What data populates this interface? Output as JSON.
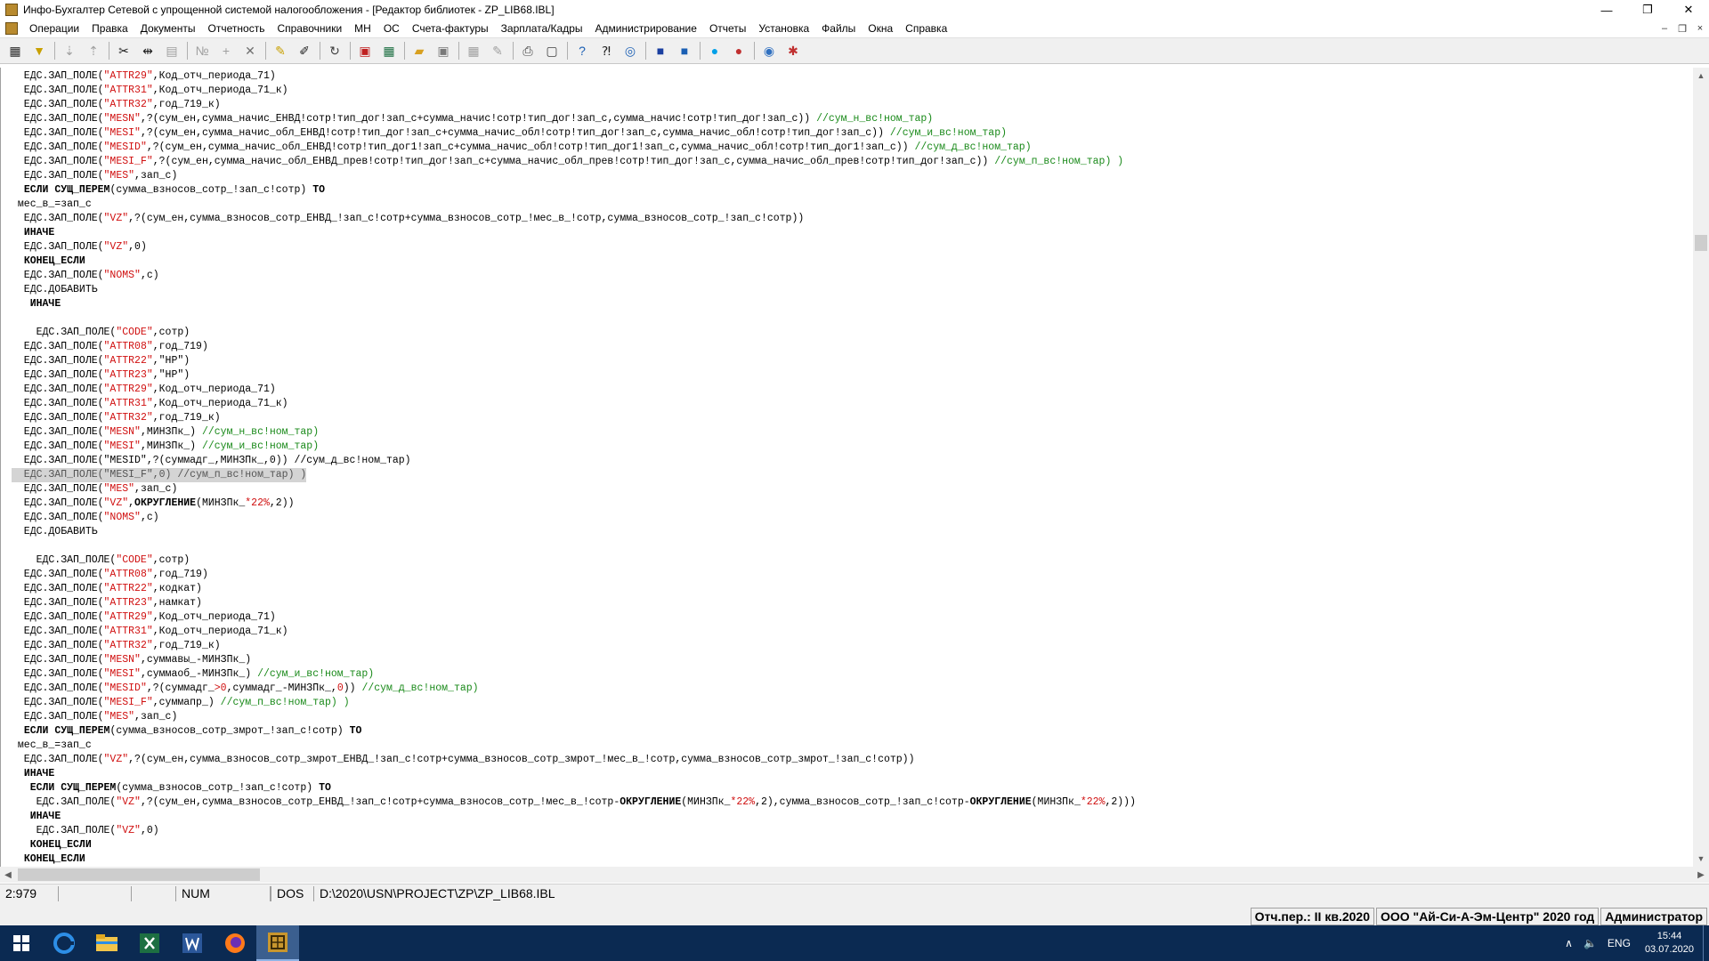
{
  "window": {
    "title": "Инфо-Бухгалтер Сетевой с упрощенной системой налогообложения - [Редактор библиотек - ZP_LIB68.IBL]",
    "minimize_glyph": "—",
    "restore_glyph": "❐",
    "close_glyph": "✕"
  },
  "menu": {
    "items": [
      "Операции",
      "Правка",
      "Документы",
      "Отчетность",
      "Справочники",
      "МН",
      "ОС",
      "Счета-фактуры",
      "Зарплата/Кадры",
      "Администрирование",
      "Отчеты",
      "Установка",
      "Файлы",
      "Окна",
      "Справка"
    ],
    "mdi_minimize_glyph": "–",
    "mdi_restore_glyph": "❐",
    "mdi_close_glyph": "×"
  },
  "toolbar": {
    "buttons": [
      {
        "name": "calculator-icon",
        "glyph": "▦",
        "color": "#2b2b2b"
      },
      {
        "name": "filter-icon",
        "glyph": "▼",
        "color": "#c8a000"
      },
      {
        "sep": true
      },
      {
        "name": "sort-asc-icon",
        "glyph": "⇣",
        "color": "#a0a0a0"
      },
      {
        "name": "sort-desc-icon",
        "glyph": "⇡",
        "color": "#a0a0a0"
      },
      {
        "sep": true
      },
      {
        "name": "cut-icon",
        "glyph": "✂",
        "color": "#202020"
      },
      {
        "name": "split-icon",
        "glyph": "⇹",
        "color": "#202020"
      },
      {
        "name": "paste-icon",
        "glyph": "▤",
        "color": "#a0a0a0"
      },
      {
        "sep": true
      },
      {
        "name": "number-icon",
        "glyph": "№",
        "color": "#a0a0a0"
      },
      {
        "name": "add-icon",
        "glyph": "+",
        "color": "#a0a0a0"
      },
      {
        "name": "delete-icon",
        "glyph": "✕",
        "color": "#707070"
      },
      {
        "sep": true
      },
      {
        "name": "pen-icon",
        "glyph": "✎",
        "color": "#c8a000"
      },
      {
        "name": "replace-icon",
        "glyph": "✐",
        "color": "#202020"
      },
      {
        "sep": true
      },
      {
        "name": "refresh-icon",
        "glyph": "↻",
        "color": "#404040"
      },
      {
        "sep": true
      },
      {
        "name": "pdf-icon",
        "glyph": "▣",
        "color": "#c02020"
      },
      {
        "name": "excel-icon",
        "glyph": "▦",
        "color": "#1d6f42"
      },
      {
        "sep": true
      },
      {
        "name": "open-folder-icon",
        "glyph": "▰",
        "color": "#d8a020"
      },
      {
        "name": "save-icon",
        "glyph": "▣",
        "color": "#7a7a7a"
      },
      {
        "sep": true
      },
      {
        "name": "calc-disabled-icon",
        "glyph": "▦",
        "color": "#a0a0a0"
      },
      {
        "name": "edit-disabled-icon",
        "glyph": "✎",
        "color": "#a0a0a0"
      },
      {
        "sep": true
      },
      {
        "name": "print-icon",
        "glyph": "⎙",
        "color": "#404040"
      },
      {
        "name": "preview-icon",
        "glyph": "▢",
        "color": "#404040"
      },
      {
        "sep": true
      },
      {
        "name": "help-icon",
        "glyph": "?",
        "color": "#1a5fb4"
      },
      {
        "name": "context-help-icon",
        "glyph": "⁈",
        "color": "#202020"
      },
      {
        "name": "compass-icon",
        "glyph": "◎",
        "color": "#1a5fb4"
      },
      {
        "sep": true
      },
      {
        "name": "app-icon",
        "glyph": "■",
        "color": "#1a3fa0"
      },
      {
        "name": "ms-icon",
        "glyph": "■",
        "color": "#1a5fb4"
      },
      {
        "sep": true
      },
      {
        "name": "skype-icon",
        "glyph": "●",
        "color": "#00a0e8"
      },
      {
        "name": "support-icon",
        "glyph": "●",
        "color": "#c03030"
      },
      {
        "sep": true
      },
      {
        "name": "globe-icon",
        "glyph": "◉",
        "color": "#3070c0"
      },
      {
        "name": "network-icon",
        "glyph": "✱",
        "color": "#c03030"
      }
    ]
  },
  "editor": {
    "selected_line": 28,
    "lines": [
      [
        [
          "  ЕДС.ЗАП_ПОЛЕ(",
          "n"
        ],
        [
          "\"ATTR29\"",
          "s"
        ],
        [
          ",Код_отч_периода_71)",
          "n"
        ]
      ],
      [
        [
          "  ЕДС.ЗАП_ПОЛЕ(",
          "n"
        ],
        [
          "\"ATTR31\"",
          "s"
        ],
        [
          ",Код_отч_периода_71_к)",
          "n"
        ]
      ],
      [
        [
          "  ЕДС.ЗАП_ПОЛЕ(",
          "n"
        ],
        [
          "\"ATTR32\"",
          "s"
        ],
        [
          ",год_719_к)",
          "n"
        ]
      ],
      [
        [
          "  ЕДС.ЗАП_ПОЛЕ(",
          "n"
        ],
        [
          "\"MESN\"",
          "s"
        ],
        [
          ",?(сум_ен,сумма_начис_ЕНВД!сотр!тип_дог!зап_с+сумма_начис!сотр!тип_дог!зап_с,сумма_начис!сотр!тип_дог!зап_с)) ",
          "n"
        ],
        [
          "//сум_н_вс!ном_тар)",
          "c"
        ]
      ],
      [
        [
          "  ЕДС.ЗАП_ПОЛЕ(",
          "n"
        ],
        [
          "\"MESI\"",
          "s"
        ],
        [
          ",?(сум_ен,сумма_начис_обл_ЕНВД!сотр!тип_дог!зап_с+сумма_начис_обл!сотр!тип_дог!зап_с,сумма_начис_обл!сотр!тип_дог!зап_с)) ",
          "n"
        ],
        [
          "//сум_и_вс!ном_тар)",
          "c"
        ]
      ],
      [
        [
          "  ЕДС.ЗАП_ПОЛЕ(",
          "n"
        ],
        [
          "\"MESID\"",
          "s"
        ],
        [
          ",?(сум_ен,сумма_начис_обл_ЕНВД!сотр!тип_дог1!зап_с+сумма_начис_обл!сотр!тип_дог1!зап_с,сумма_начис_обл!сотр!тип_дог1!зап_с)) ",
          "n"
        ],
        [
          "//сум_д_вс!ном_тар)",
          "c"
        ]
      ],
      [
        [
          "  ЕДС.ЗАП_ПОЛЕ(",
          "n"
        ],
        [
          "\"MESI_F\"",
          "s"
        ],
        [
          ",?(сум_ен,сумма_начис_обл_ЕНВД_прев!сотр!тип_дог!зап_с+сумма_начис_обл_прев!сотр!тип_дог!зап_с,сумма_начис_обл_прев!сотр!тип_дог!зап_с)) ",
          "n"
        ],
        [
          "//сум_п_вс!ном_тар) )",
          "c"
        ]
      ],
      [
        [
          "  ЕДС.ЗАП_ПОЛЕ(",
          "n"
        ],
        [
          "\"MES\"",
          "s"
        ],
        [
          ",зап_с)",
          "n"
        ]
      ],
      [
        [
          "  ",
          "n"
        ],
        [
          "ЕСЛИ СУЩ_ПЕРЕМ",
          "k"
        ],
        [
          "(сумма_взносов_сотр_!зап_с!сотр) ",
          "n"
        ],
        [
          "ТО",
          "k"
        ]
      ],
      [
        [
          " мес_в_=зап_с",
          "n"
        ]
      ],
      [
        [
          "  ЕДС.ЗАП_ПОЛЕ(",
          "n"
        ],
        [
          "\"VZ\"",
          "s"
        ],
        [
          ",?(сум_ен,сумма_взносов_сотр_ЕНВД_!зап_с!сотр+сумма_взносов_сотр_!мес_в_!сотр,сумма_взносов_сотр_!зап_с!сотр))",
          "n"
        ]
      ],
      [
        [
          "  ",
          "n"
        ],
        [
          "ИНАЧЕ",
          "k"
        ]
      ],
      [
        [
          "  ЕДС.ЗАП_ПОЛЕ(",
          "n"
        ],
        [
          "\"VZ\"",
          "s"
        ],
        [
          ",0)",
          "n"
        ]
      ],
      [
        [
          "  ",
          "n"
        ],
        [
          "КОНЕЦ_ЕСЛИ",
          "k"
        ]
      ],
      [
        [
          "  ЕДС.ЗАП_ПОЛЕ(",
          "n"
        ],
        [
          "\"NOMS\"",
          "s"
        ],
        [
          ",с)",
          "n"
        ]
      ],
      [
        [
          "  ЕДС.ДОБАВИТЬ",
          "n"
        ]
      ],
      [
        [
          "   ",
          "n"
        ],
        [
          "ИНАЧЕ",
          "k"
        ]
      ],
      [
        [
          "",
          "n"
        ]
      ],
      [
        [
          "    ЕДС.ЗАП_ПОЛЕ(",
          "n"
        ],
        [
          "\"CODE\"",
          "s"
        ],
        [
          ",сотр)",
          "n"
        ]
      ],
      [
        [
          "  ЕДС.ЗАП_ПОЛЕ(",
          "n"
        ],
        [
          "\"ATTR08\"",
          "s"
        ],
        [
          ",год_719)",
          "n"
        ]
      ],
      [
        [
          "  ЕДС.ЗАП_ПОЛЕ(",
          "n"
        ],
        [
          "\"ATTR22\"",
          "s"
        ],
        [
          ",\"НР\")",
          "n"
        ]
      ],
      [
        [
          "  ЕДС.ЗАП_ПОЛЕ(",
          "n"
        ],
        [
          "\"ATTR23\"",
          "s"
        ],
        [
          ",\"НР\")",
          "n"
        ]
      ],
      [
        [
          "  ЕДС.ЗАП_ПОЛЕ(",
          "n"
        ],
        [
          "\"ATTR29\"",
          "s"
        ],
        [
          ",Код_отч_периода_71)",
          "n"
        ]
      ],
      [
        [
          "  ЕДС.ЗАП_ПОЛЕ(",
          "n"
        ],
        [
          "\"ATTR31\"",
          "s"
        ],
        [
          ",Код_отч_периода_71_к)",
          "n"
        ]
      ],
      [
        [
          "  ЕДС.ЗАП_ПОЛЕ(",
          "n"
        ],
        [
          "\"ATTR32\"",
          "s"
        ],
        [
          ",год_719_к)",
          "n"
        ]
      ],
      [
        [
          "  ЕДС.ЗАП_ПОЛЕ(",
          "n"
        ],
        [
          "\"MESN\"",
          "s"
        ],
        [
          ",МИНЗПк_) ",
          "n"
        ],
        [
          "//сум_н_вс!ном_тар)",
          "c"
        ]
      ],
      [
        [
          "  ЕДС.ЗАП_ПОЛЕ(",
          "n"
        ],
        [
          "\"MESI\"",
          "s"
        ],
        [
          ",МИНЗПк_) ",
          "n"
        ],
        [
          "//сум_и_вс!ном_тар)",
          "c"
        ]
      ],
      [
        [
          "  ЕДС.ЗАП_ПОЛЕ(\"MESID\",?(суммадг_,МИНЗПк_,0)) //сум_д_вс!ном_тар)",
          "n"
        ]
      ],
      [
        [
          "  ЕДС.ЗАП_ПОЛЕ(",
          "n"
        ],
        [
          "\"MESI_F\"",
          "s"
        ],
        [
          ",0) ",
          "n"
        ],
        [
          "//сум_п_вс!ном_тар) )",
          "c"
        ]
      ],
      [
        [
          "  ЕДС.ЗАП_ПОЛЕ(",
          "n"
        ],
        [
          "\"MES\"",
          "s"
        ],
        [
          ",зап_с)",
          "n"
        ]
      ],
      [
        [
          "  ЕДС.ЗАП_ПОЛЕ(",
          "n"
        ],
        [
          "\"VZ\"",
          "s"
        ],
        [
          ",",
          "n"
        ],
        [
          "ОКРУГЛЕНИЕ",
          "k"
        ],
        [
          "(МИНЗПк_",
          "n"
        ],
        [
          "*22%",
          "s"
        ],
        [
          ",2))",
          "n"
        ]
      ],
      [
        [
          "  ЕДС.ЗАП_ПОЛЕ(",
          "n"
        ],
        [
          "\"NOMS\"",
          "s"
        ],
        [
          ",с)",
          "n"
        ]
      ],
      [
        [
          "  ЕДС.ДОБАВИТЬ",
          "n"
        ]
      ],
      [
        [
          "",
          "n"
        ]
      ],
      [
        [
          "    ЕДС.ЗАП_ПОЛЕ(",
          "n"
        ],
        [
          "\"CODE\"",
          "s"
        ],
        [
          ",сотр)",
          "n"
        ]
      ],
      [
        [
          "  ЕДС.ЗАП_ПОЛЕ(",
          "n"
        ],
        [
          "\"ATTR08\"",
          "s"
        ],
        [
          ",год_719)",
          "n"
        ]
      ],
      [
        [
          "  ЕДС.ЗАП_ПОЛЕ(",
          "n"
        ],
        [
          "\"ATTR22\"",
          "s"
        ],
        [
          ",кодкат)",
          "n"
        ]
      ],
      [
        [
          "  ЕДС.ЗАП_ПОЛЕ(",
          "n"
        ],
        [
          "\"ATTR23\"",
          "s"
        ],
        [
          ",намкат)",
          "n"
        ]
      ],
      [
        [
          "  ЕДС.ЗАП_ПОЛЕ(",
          "n"
        ],
        [
          "\"ATTR29\"",
          "s"
        ],
        [
          ",Код_отч_периода_71)",
          "n"
        ]
      ],
      [
        [
          "  ЕДС.ЗАП_ПОЛЕ(",
          "n"
        ],
        [
          "\"ATTR31\"",
          "s"
        ],
        [
          ",Код_отч_периода_71_к)",
          "n"
        ]
      ],
      [
        [
          "  ЕДС.ЗАП_ПОЛЕ(",
          "n"
        ],
        [
          "\"ATTR32\"",
          "s"
        ],
        [
          ",год_719_к)",
          "n"
        ]
      ],
      [
        [
          "  ЕДС.ЗАП_ПОЛЕ(",
          "n"
        ],
        [
          "\"MESN\"",
          "s"
        ],
        [
          ",суммавы_-МИНЗПк_)",
          "n"
        ]
      ],
      [
        [
          "  ЕДС.ЗАП_ПОЛЕ(",
          "n"
        ],
        [
          "\"MESI\"",
          "s"
        ],
        [
          ",суммаоб_-МИНЗПк_) ",
          "n"
        ],
        [
          "//сум_и_вс!ном_тар)",
          "c"
        ]
      ],
      [
        [
          "  ЕДС.ЗАП_ПОЛЕ(",
          "n"
        ],
        [
          "\"MESID\"",
          "s"
        ],
        [
          ",?(суммадг_",
          "n"
        ],
        [
          ">0",
          "s"
        ],
        [
          ",суммадг_-МИНЗПк_,",
          "n"
        ],
        [
          "0",
          "s"
        ],
        [
          ")) ",
          "n"
        ],
        [
          "//сум_д_вс!ном_тар)",
          "c"
        ]
      ],
      [
        [
          "  ЕДС.ЗАП_ПОЛЕ(",
          "n"
        ],
        [
          "\"MESI_F\"",
          "s"
        ],
        [
          ",суммапр_) ",
          "n"
        ],
        [
          "//сум_п_вс!ном_тар) )",
          "c"
        ]
      ],
      [
        [
          "  ЕДС.ЗАП_ПОЛЕ(",
          "n"
        ],
        [
          "\"MES\"",
          "s"
        ],
        [
          ",зап_с)",
          "n"
        ]
      ],
      [
        [
          "  ",
          "n"
        ],
        [
          "ЕСЛИ СУЩ_ПЕРЕМ",
          "k"
        ],
        [
          "(сумма_взносов_сотр_змрот_!зап_с!сотр) ",
          "n"
        ],
        [
          "ТО",
          "k"
        ]
      ],
      [
        [
          " мес_в_=зап_с",
          "n"
        ]
      ],
      [
        [
          "  ЕДС.ЗАП_ПОЛЕ(",
          "n"
        ],
        [
          "\"VZ\"",
          "s"
        ],
        [
          ",?(сум_ен,сумма_взносов_сотр_змрот_ЕНВД_!зап_с!сотр+сумма_взносов_сотр_змрот_!мес_в_!сотр,сумма_взносов_сотр_змрот_!зап_с!сотр))",
          "n"
        ]
      ],
      [
        [
          "  ",
          "n"
        ],
        [
          "ИНАЧЕ",
          "k"
        ]
      ],
      [
        [
          "   ",
          "n"
        ],
        [
          "ЕСЛИ СУЩ_ПЕРЕМ",
          "k"
        ],
        [
          "(сумма_взносов_сотр_!зап_с!сотр) ",
          "n"
        ],
        [
          "ТО",
          "k"
        ]
      ],
      [
        [
          "    ЕДС.ЗАП_ПОЛЕ(",
          "n"
        ],
        [
          "\"VZ\"",
          "s"
        ],
        [
          ",?(сум_ен,сумма_взносов_сотр_ЕНВД_!зап_с!сотр+сумма_взносов_сотр_!мес_в_!сотр-",
          "n"
        ],
        [
          "ОКРУГЛЕНИЕ",
          "k"
        ],
        [
          "(МИНЗПк_",
          "n"
        ],
        [
          "*22%",
          "s"
        ],
        [
          ",2),сумма_взносов_сотр_!зап_с!сотр-",
          "n"
        ],
        [
          "ОКРУГЛЕНИЕ",
          "k"
        ],
        [
          "(МИНЗПк_",
          "n"
        ],
        [
          "*22%",
          "s"
        ],
        [
          ",2)))",
          "n"
        ]
      ],
      [
        [
          "   ",
          "n"
        ],
        [
          "ИНАЧЕ",
          "k"
        ]
      ],
      [
        [
          "    ЕДС.ЗАП_ПОЛЕ(",
          "n"
        ],
        [
          "\"VZ\"",
          "s"
        ],
        [
          ",0)",
          "n"
        ]
      ],
      [
        [
          "   ",
          "n"
        ],
        [
          "КОНЕЦ_ЕСЛИ",
          "k"
        ]
      ],
      [
        [
          "  ",
          "n"
        ],
        [
          "КОНЕЦ_ЕСЛИ",
          "k"
        ]
      ]
    ]
  },
  "scroll": {
    "up_glyph": "▲",
    "down_glyph": "▼",
    "left_glyph": "◀",
    "right_glyph": "▶"
  },
  "status": {
    "position": "2:979",
    "cell2": "",
    "cell3": "",
    "num": "NUM",
    "cell5": "",
    "encoding": "DOS",
    "path": "D:\\2020\\USN\\PROJECT\\ZP\\ZP_LIB68.IBL"
  },
  "info": {
    "period": "Отч.пер.: II кв.2020",
    "company": "ООО \"Ай-Си-А-Эм-Центр\" 2020 год",
    "user": "Администратор"
  },
  "taskbar": {
    "language": "ENG",
    "tray_up_glyph": "∧",
    "volume_glyph": "🔈",
    "time": "15:44",
    "date": "03.07.2020"
  }
}
